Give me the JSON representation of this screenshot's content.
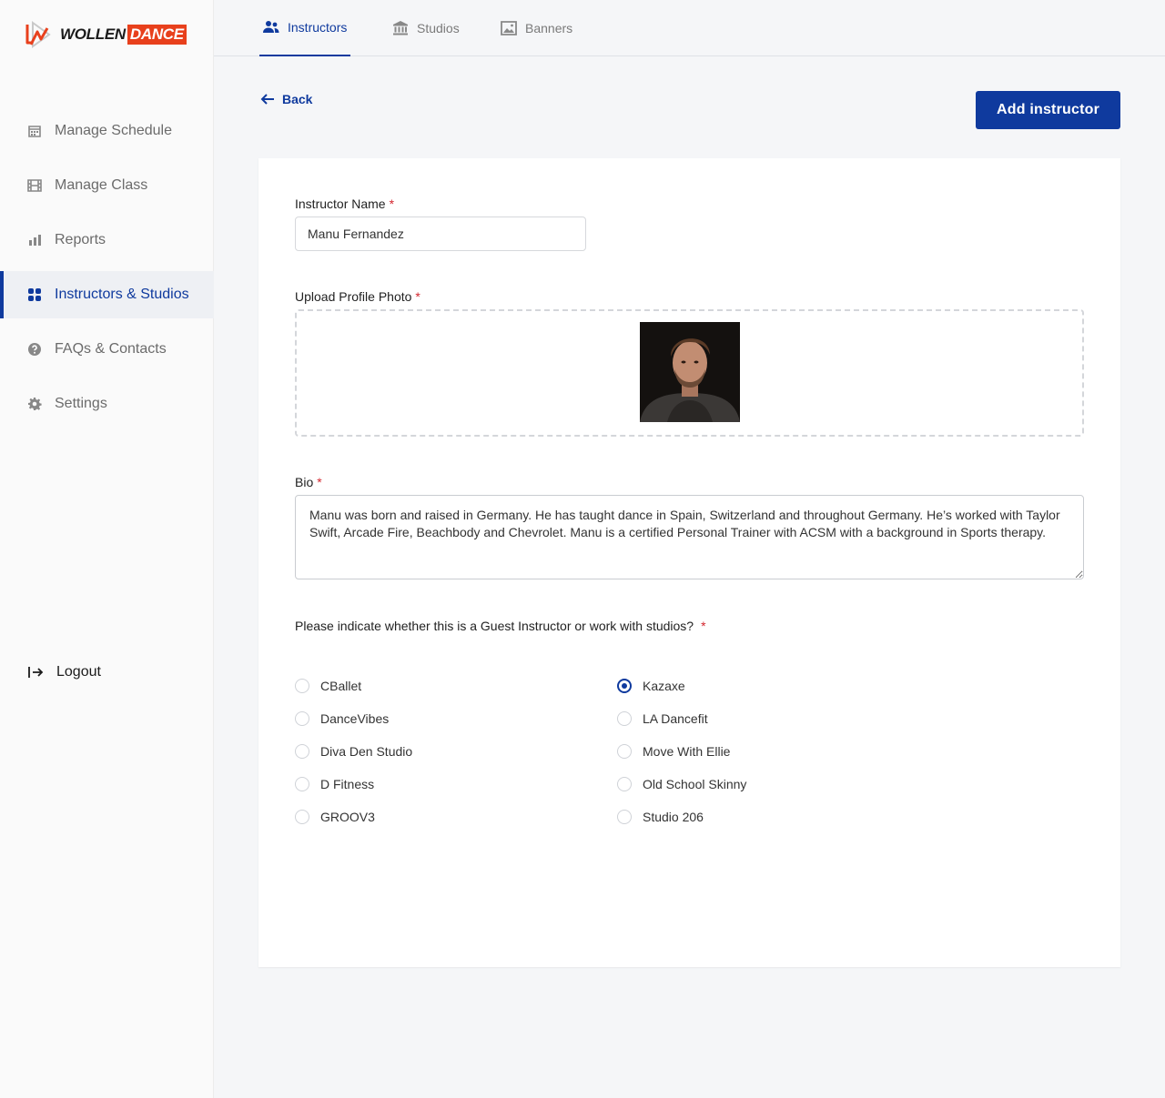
{
  "brand": {
    "name_part1": "WOLLEN",
    "name_part2": "DANCE",
    "accent": "#e8401c",
    "primary": "#0f3a9e"
  },
  "sidebar": {
    "items": [
      {
        "label": "Manage Schedule",
        "icon": "calendar-icon",
        "active": false
      },
      {
        "label": "Manage Class",
        "icon": "film-icon",
        "active": false
      },
      {
        "label": "Reports",
        "icon": "bar-chart-icon",
        "active": false
      },
      {
        "label": "Instructors & Studios",
        "icon": "grid-icon",
        "active": true
      },
      {
        "label": "FAQs & Contacts",
        "icon": "help-icon",
        "active": false
      },
      {
        "label": "Settings",
        "icon": "gear-icon",
        "active": false
      }
    ],
    "logout_label": "Logout"
  },
  "tabs": [
    {
      "label": "Instructors",
      "icon": "users-icon",
      "active": true
    },
    {
      "label": "Studios",
      "icon": "bank-icon",
      "active": false
    },
    {
      "label": "Banners",
      "icon": "image-icon",
      "active": false
    }
  ],
  "toolbar": {
    "back_label": "Back",
    "add_label": "Add instructor"
  },
  "form": {
    "name_label": "Instructor Name",
    "name_value": "Manu Fernandez",
    "photo_label": "Upload Profile Photo",
    "bio_label": "Bio",
    "bio_value": "Manu was born and raised in Germany. He has taught dance in Spain, Switzerland and throughout Germany. He’s worked with Taylor Swift, Arcade Fire, Beachbody and Chevrolet. Manu is a certified Personal Trainer with ACSM with a background in Sports therapy.",
    "studios_question": "Please indicate whether this is a Guest Instructor or work with studios?",
    "required_mark": "*",
    "studios": [
      {
        "label": "CBallet",
        "selected": false
      },
      {
        "label": "DanceVibes",
        "selected": false
      },
      {
        "label": "Diva Den Studio",
        "selected": false
      },
      {
        "label": "D Fitness",
        "selected": false
      },
      {
        "label": "GROOV3",
        "selected": false
      },
      {
        "label": "Kazaxe",
        "selected": true
      },
      {
        "label": "LA Dancefit",
        "selected": false
      },
      {
        "label": "Move With Ellie",
        "selected": false
      },
      {
        "label": "Old School Skinny",
        "selected": false
      },
      {
        "label": "Studio 206",
        "selected": false
      }
    ]
  }
}
